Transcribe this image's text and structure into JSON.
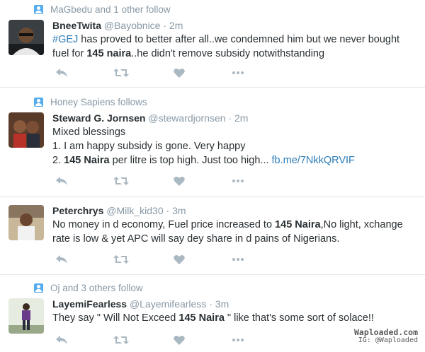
{
  "tweets": [
    {
      "context": "MaGbedu and 1 other follow",
      "name": "BneeTwita",
      "handle": "@Bayobnice",
      "time": "· 2m",
      "line1": {
        "hashtag": "#GEJ",
        "t1": " has proved to better after all..we condemned him but we never bought"
      },
      "line2": {
        "t1": "fuel for ",
        "bold": "145 naira",
        "t2": "..he didn't remove subsidy notwithstanding"
      }
    },
    {
      "context": "Honey Sapiens follows",
      "name": "Steward G. Jornsen",
      "handle": "@stewardjornsen",
      "time": "· 2m",
      "line1": "Mixed blessings",
      "line2": "1. I am happy subsidy is gone. Very happy",
      "line3": {
        "t1": "2. ",
        "bold": "145 Naira",
        "t2": " per litre is top high. Just too high... ",
        "link": "fb.me/7NkkQRVIF"
      }
    },
    {
      "name": "Peterchrys",
      "handle": "@Milk_kid30",
      "time": "· 3m",
      "line1": {
        "t1": "No money in d economy, Fuel price increased to ",
        "bold": "145 Naira",
        "t2": ",No light, xchange"
      },
      "line2": "rate is low & yet APC will say dey share in d pains of Nigerians."
    },
    {
      "context": "Oj and 3 others follow",
      "name": "LayemiFearless",
      "handle": "@Layemifearless",
      "time": "· 3m",
      "line1": {
        "t1": "They say \" Will Not Exceed ",
        "bold": "145 Naira",
        "t2": " \" like that's some sort of solace!!"
      }
    }
  ],
  "icons": [
    "reply-icon",
    "retweet-icon",
    "like-icon",
    "more-icon"
  ],
  "colors": {
    "accent": "#55acee",
    "link": "#2b7bb9",
    "muted": "#8899a6",
    "icon": "#aab8c2"
  },
  "watermark": {
    "line1": "Waploaded.com",
    "line2": "IG: @Waploaded"
  }
}
